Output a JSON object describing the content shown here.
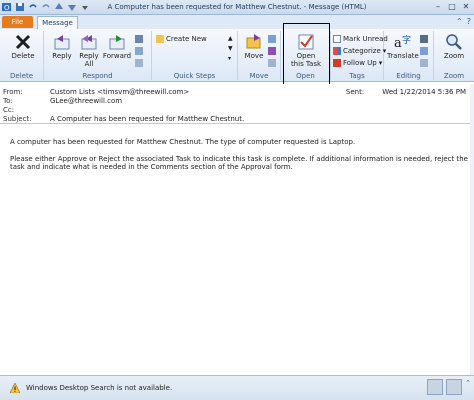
{
  "window": {
    "title": "A Computer has been requested for Matthew Chestnut. - Message (HTML)",
    "minimize": "–",
    "maximize": "□",
    "close": "✕"
  },
  "tabs": {
    "file": "File",
    "message": "Message",
    "help": "?"
  },
  "ribbon": {
    "delete_group": {
      "label": "Delete",
      "delete": "Delete"
    },
    "respond_group": {
      "label": "Respond",
      "reply": "Reply",
      "reply_all_1": "Reply",
      "reply_all_2": "All",
      "forward": "Forward"
    },
    "quick_steps_group": {
      "label": "Quick Steps",
      "create_new": "Create New"
    },
    "move_group": {
      "label": "Move",
      "move": "Move"
    },
    "open_group": {
      "label": "Open",
      "open_1": "Open",
      "open_2": "this Task"
    },
    "tags_group": {
      "label": "Tags",
      "mark_unread": "Mark Unread",
      "categorize": "Categorize",
      "follow_up": "Follow Up"
    },
    "editing_group": {
      "label": "Editing",
      "translate": "Translate"
    },
    "zoom_group": {
      "label": "Zoom",
      "zoom": "Zoom"
    }
  },
  "header": {
    "from_label": "From:",
    "from_value": "Custom Lists <timsvm@threewill.com>",
    "to_label": "To:",
    "to_value": "GLee@threewill.com",
    "cc_label": "Cc:",
    "cc_value": "",
    "subject_label": "Subject:",
    "subject_value": "A Computer has been requested for Matthew Chestnut.",
    "sent_label": "Sent:",
    "sent_value": "Wed 1/22/2014 5:36 PM"
  },
  "body": {
    "line1": "A computer has been requested for Matthew Chestnut.  The type of computer requested is Laptop.",
    "line2": "Please either Approve or Reject the associated Task to indicate this task is complete.  If additional information is needed, reject the task and indicate what is needed in the Comments section of the Approval form."
  },
  "statusbar": {
    "warning": "Windows Desktop Search is not available."
  },
  "colors": {
    "file_tab": "#e87b1b",
    "ribbon_bg": "#dce7f5",
    "accent": "#1e395b"
  }
}
